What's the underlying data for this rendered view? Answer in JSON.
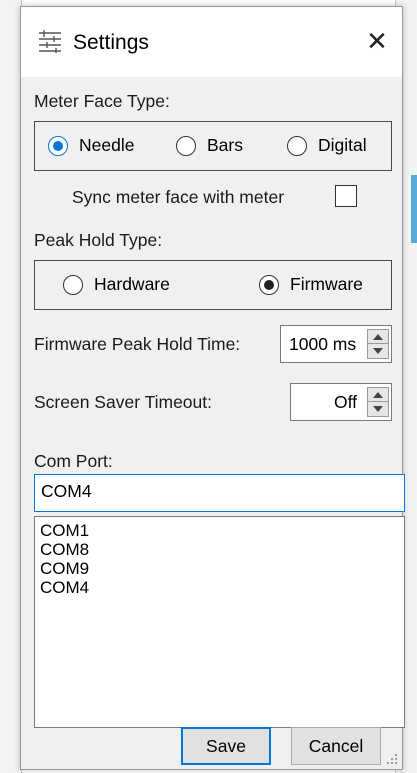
{
  "window": {
    "title": "Settings",
    "close_glyph": "✕",
    "icon": "settings-app-icon"
  },
  "meter_face": {
    "label": "Meter Face Type:",
    "options": [
      {
        "label": "Needle",
        "selected": true
      },
      {
        "label": "Bars",
        "selected": false
      },
      {
        "label": "Digital",
        "selected": false
      }
    ]
  },
  "sync": {
    "label": "Sync meter face with meter",
    "checked": false
  },
  "peak_hold": {
    "label": "Peak Hold Type:",
    "options": [
      {
        "label": "Hardware",
        "selected": false
      },
      {
        "label": "Firmware",
        "selected": true
      }
    ]
  },
  "firmware_peak_hold_time": {
    "label": "Firmware Peak Hold Time:",
    "value": "1000 ms"
  },
  "screen_saver": {
    "label": "Screen Saver Timeout:",
    "value": "Off"
  },
  "com_port": {
    "label": "Com Port:",
    "value": "COM4",
    "list": [
      "COM1",
      "COM8",
      "COM9",
      "COM4"
    ]
  },
  "buttons": {
    "save": "Save",
    "cancel": "Cancel"
  },
  "colors": {
    "accent": "#0078d7",
    "window_bg": "#f0f0f0"
  }
}
